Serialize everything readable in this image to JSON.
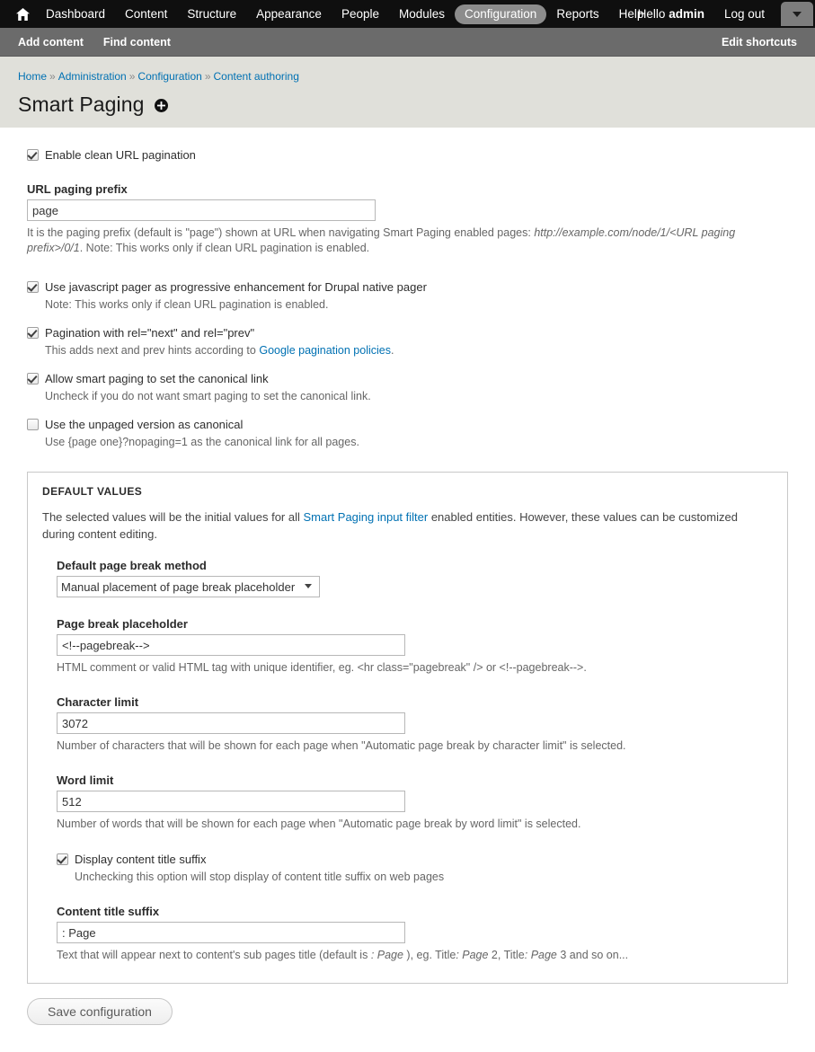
{
  "toolbar": {
    "home_icon": "home-icon",
    "menu": [
      {
        "label": "Dashboard",
        "active": false
      },
      {
        "label": "Content",
        "active": false
      },
      {
        "label": "Structure",
        "active": false
      },
      {
        "label": "Appearance",
        "active": false
      },
      {
        "label": "People",
        "active": false
      },
      {
        "label": "Modules",
        "active": false
      },
      {
        "label": "Configuration",
        "active": true
      },
      {
        "label": "Reports",
        "active": false
      },
      {
        "label": "Help",
        "active": false
      }
    ],
    "greeting_prefix": "Hello ",
    "user_name": "admin",
    "logout_label": "Log out",
    "toggle_icon": "chevron-down-icon"
  },
  "shortcuts": {
    "items": [
      {
        "label": "Add content"
      },
      {
        "label": "Find content"
      }
    ],
    "edit_label": "Edit shortcuts"
  },
  "breadcrumb": {
    "separator": "»",
    "items": [
      {
        "label": "Home"
      },
      {
        "label": "Administration"
      },
      {
        "label": "Configuration"
      },
      {
        "label": "Content authoring"
      }
    ]
  },
  "page": {
    "title": "Smart Paging",
    "add_shortcut_icon": "add-shortcut-icon"
  },
  "form": {
    "clean_url": {
      "label": "Enable clean URL pagination",
      "checked": true
    },
    "url_prefix": {
      "label": "URL paging prefix",
      "value": "page",
      "desc_part1": "It is the paging prefix (default is \"page\") shown at URL when navigating Smart Paging enabled pages: ",
      "desc_em": "http://example.com/node/1/<URL paging prefix>/0/1",
      "desc_part2": ". Note: This works only if clean URL pagination is enabled."
    },
    "js_pager": {
      "label": "Use javascript pager as progressive enhancement for Drupal native pager",
      "checked": true,
      "note": "Note: This works only if clean URL pagination is enabled."
    },
    "rel_next_prev": {
      "label": "Pagination with rel=\"next\" and rel=\"prev\"",
      "checked": true,
      "note_prefix": "This adds next and prev hints according to ",
      "note_link": "Google pagination policies",
      "note_suffix": "."
    },
    "canonical": {
      "label": "Allow smart paging to set the canonical link",
      "checked": true,
      "note": "Uncheck if you do not want smart paging to set the canonical link."
    },
    "unpaged_canonical": {
      "label": "Use the unpaged version as canonical",
      "checked": false,
      "note": "Use {page one}?nopaging=1 as the canonical link for all pages."
    },
    "defaults": {
      "legend": "DEFAULT VALUES",
      "desc_part1": "The selected values will be the initial values for all ",
      "desc_link": "Smart Paging input filter",
      "desc_part2": " enabled entities. However, these values can be customized during content editing.",
      "break_method": {
        "label": "Default page break method",
        "selected": "Manual placement of page break placeholder",
        "options": [
          "Manual placement of page break placeholder",
          "Automatic page break by character limit",
          "Automatic page break by word limit"
        ]
      },
      "placeholder_field": {
        "label": "Page break placeholder",
        "value": "<!--pagebreak-->",
        "desc": "HTML comment or valid HTML tag with unique identifier, eg. <hr class=\"pagebreak\" /> or <!--pagebreak-->."
      },
      "char_limit": {
        "label": "Character limit",
        "value": "3072",
        "desc": "Number of characters that will be shown for each page when \"Automatic page break by character limit\" is selected."
      },
      "word_limit": {
        "label": "Word limit",
        "value": "512",
        "desc": "Number of words that will be shown for each page when \"Automatic page break by word limit\" is selected."
      },
      "title_suffix_toggle": {
        "label": "Display content title suffix",
        "checked": true,
        "note": "Unchecking this option will stop display of content title suffix on web pages"
      },
      "title_suffix": {
        "label": "Content title suffix",
        "value": ": Page",
        "desc_p1": "Text that will appear next to content's sub pages title (default is ",
        "desc_em1": ": Page",
        "desc_p2": " ), eg. Title",
        "desc_em2": ": Page",
        "desc_p3": " 2, Title",
        "desc_em3": ": Page",
        "desc_p4": " 3 and so on..."
      }
    },
    "save_label": "Save configuration"
  },
  "colors": {
    "toolbar_bg": "#0f0f0f",
    "shortcut_bg": "#6b6b6b",
    "band_bg": "#e0e0da",
    "link": "#0071b3",
    "active_tab": "#8c8c8c"
  }
}
